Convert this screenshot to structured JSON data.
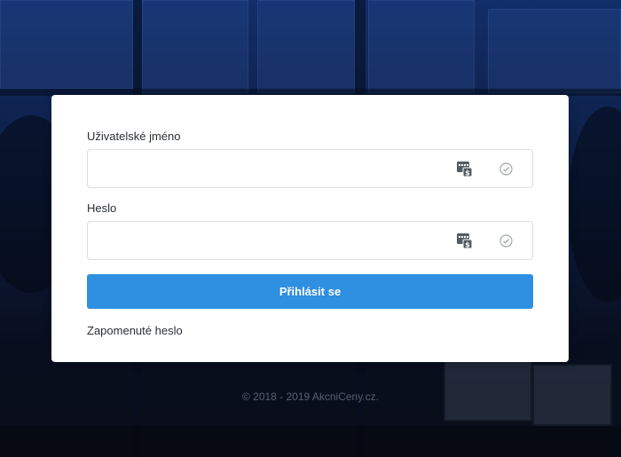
{
  "form": {
    "username_label": "Uživatelské jméno",
    "username_value": "",
    "password_label": "Heslo",
    "password_value": "",
    "submit_label": "Přihlásit se",
    "forgot_label": "Zapomenuté heslo"
  },
  "icons": {
    "password_manager": "password-manager-icon",
    "validation": "check-circle-icon"
  },
  "colors": {
    "accent": "#2f8fe0",
    "card": "#ffffff",
    "text": "#2b2f36",
    "field_border": "#d9dde3"
  },
  "footer": {
    "copyright": "© 2018 - 2019 AkcniCeny.cz."
  }
}
